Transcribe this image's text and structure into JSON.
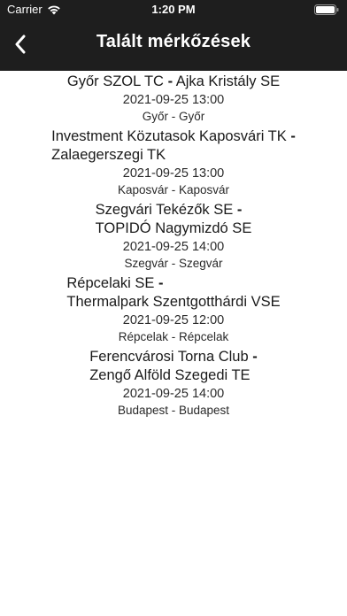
{
  "status_bar": {
    "carrier": "Carrier",
    "time": "1:20 PM"
  },
  "nav": {
    "title": "Talált mérkőzések",
    "back_icon": "chevron-left-icon"
  },
  "matches": [
    {
      "home_team": "Győr SZOL TC",
      "separator": "-",
      "away_team": "Ajka Kristály SE",
      "datetime": "2021-09-25 13:00",
      "venue": "Győr - Győr"
    },
    {
      "home_team": "Investment Közutasok Kaposvári TK",
      "separator": "-",
      "away_team": "Zalaegerszegi TK",
      "datetime": "2021-09-25 13:00",
      "venue": "Kaposvár  - Kaposvár"
    },
    {
      "home_team": "Szegvári Tekézők SE",
      "separator": "-",
      "away_team": "TOPIDÓ Nagymizdó SE",
      "datetime": "2021-09-25 14:00",
      "venue": "Szegvár  - Szegvár"
    },
    {
      "home_team": "Répcelaki SE",
      "separator": "-",
      "away_team": "Thermalpark Szentgotthárdi VSE",
      "datetime": "2021-09-25 12:00",
      "venue": "Répcelak  - Répcelak"
    },
    {
      "home_team": "Ferencvárosi Torna Club",
      "separator": "-",
      "away_team": "Zengő Alföld Szegedi TE",
      "datetime": "2021-09-25 14:00",
      "venue": "Budapest  - Budapest"
    }
  ]
}
